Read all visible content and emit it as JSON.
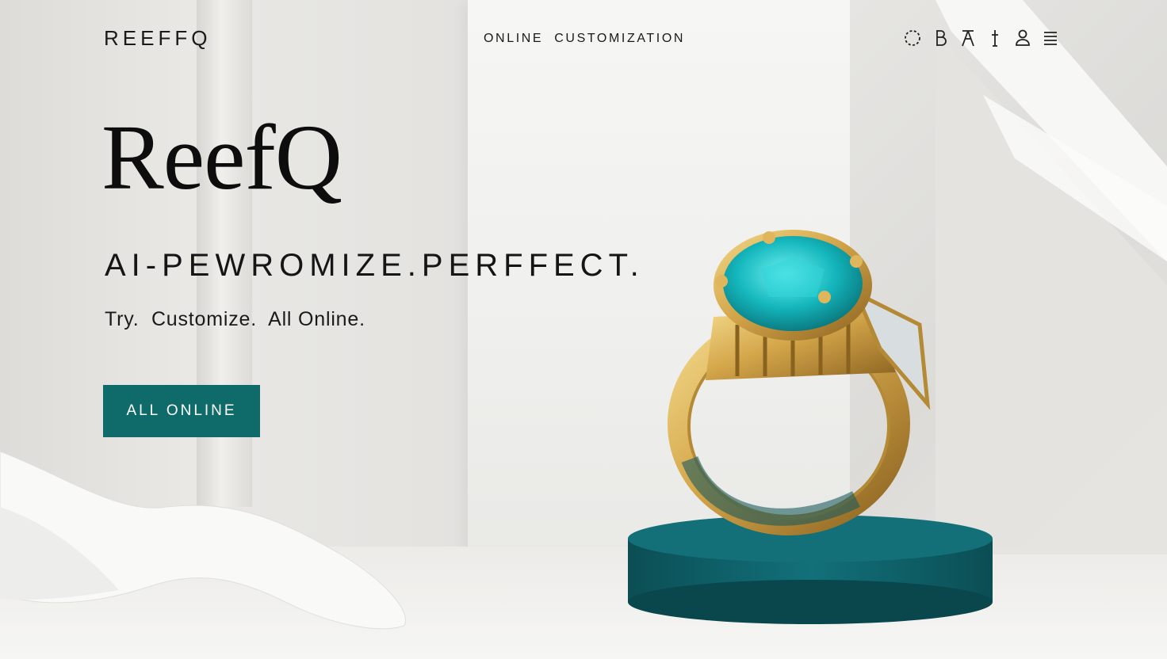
{
  "header": {
    "logo": "REEFFQ",
    "nav_link": "ONLINE  CUSTOMIZATION",
    "icons": [
      "loader-icon",
      "bold-b-icon",
      "lamp-icon",
      "tool-icon",
      "user-icon",
      "menu-icon"
    ]
  },
  "hero": {
    "title": "ReefQ",
    "tagline": "AI-PEWROMIZE.PERFFECT.",
    "subtitle": "Try.  Customize.  All Online.",
    "cta_label": "ALL ONLINE"
  },
  "colors": {
    "accent": "#0e6b6a",
    "gold": "#d4a64a",
    "gem": "#14b7bd",
    "pedestal": "#0f5e64"
  }
}
